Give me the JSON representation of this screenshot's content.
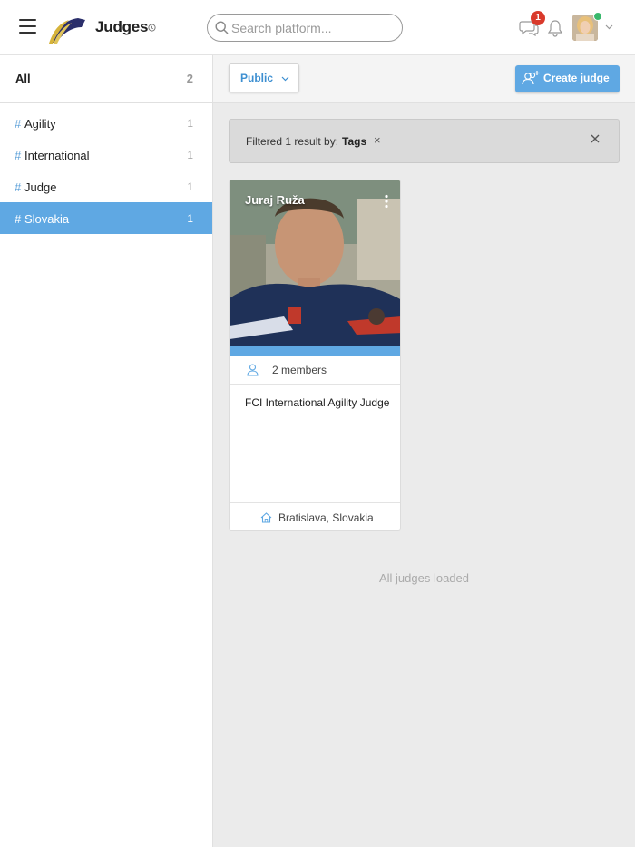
{
  "header": {
    "title": "Judges",
    "search_placeholder": "Search platform...",
    "chat_badge": "1",
    "logo_icon": "feather-logo-icon",
    "title_icon": "info-circle-icon",
    "colors": {
      "accent": "#5fa8e3",
      "badge": "#d93a2b",
      "online": "#39b86c"
    }
  },
  "sidebar": {
    "all_label": "All",
    "all_count": "2",
    "tags": [
      {
        "hash": "#",
        "label": "Agility",
        "count": "1",
        "active": false
      },
      {
        "hash": "#",
        "label": "International",
        "count": "1",
        "active": false
      },
      {
        "hash": "#",
        "label": "Judge",
        "count": "1",
        "active": false
      },
      {
        "hash": "#",
        "label": "Slovakia",
        "count": "1",
        "active": true
      }
    ]
  },
  "toolbar": {
    "visibility_label": "Public",
    "create_label": "Create judge"
  },
  "filter": {
    "text": "Filtered 1 result by:",
    "tag": "Tags",
    "remove_symbol": "×"
  },
  "cards": [
    {
      "name": "Juraj Ruža",
      "members": "2 members",
      "description": "FCI International Agility Judge",
      "location": "Bratislava, Slovakia"
    }
  ],
  "status": {
    "loaded": "All judges loaded"
  }
}
